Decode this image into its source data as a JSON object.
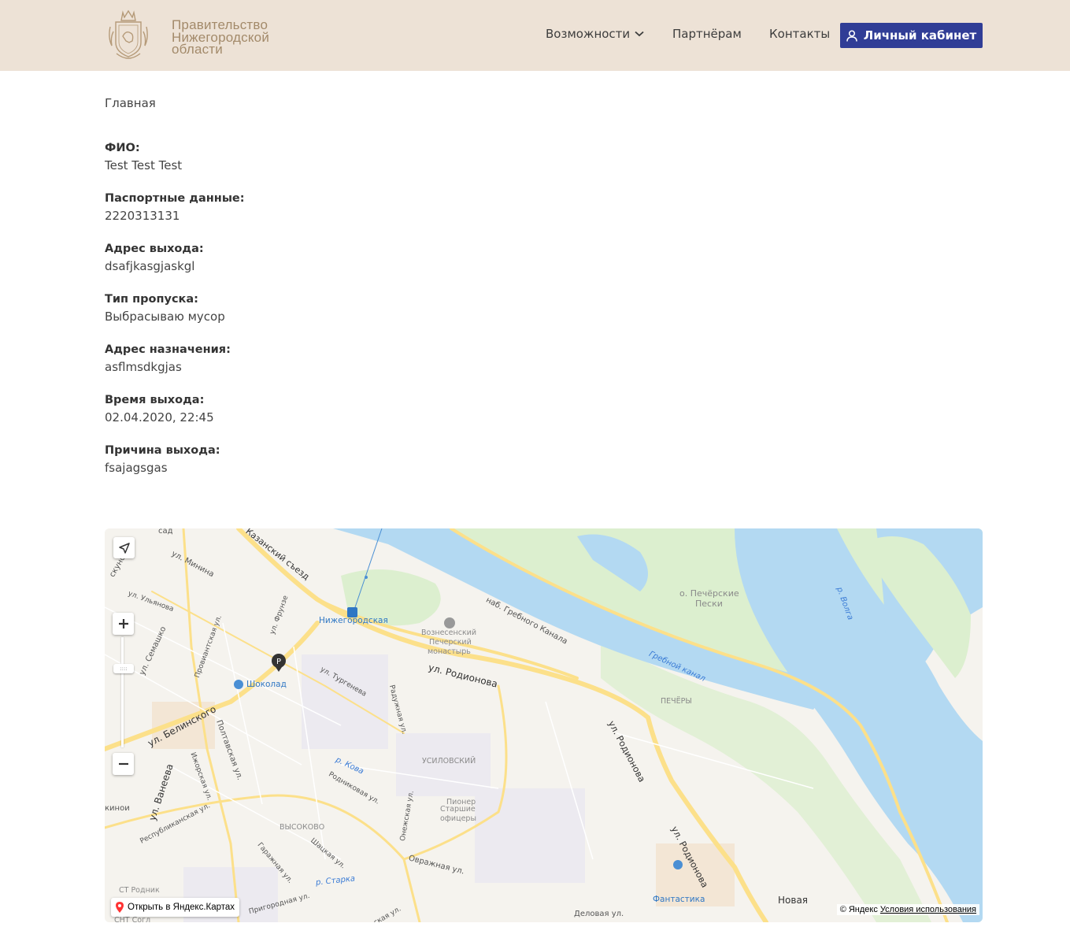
{
  "header": {
    "logo_lines": [
      "Правительство",
      "Нижегородской",
      "области"
    ],
    "nav": {
      "features": "Возможности",
      "partners": "Партнёрам",
      "contacts": "Контакты"
    },
    "cabinet_button": "Личный кабинет",
    "colors": {
      "background": "#ede2d6",
      "button": "#303d96",
      "logo_text": "#a38a6a"
    }
  },
  "breadcrumb": "Главная",
  "fields": [
    {
      "label": "ФИО:",
      "value": "Test Test Test"
    },
    {
      "label": "Паспортные данные:",
      "value": "2220313131"
    },
    {
      "label": "Адрес выхода:",
      "value": "dsafjkasgjaskgl"
    },
    {
      "label": "Тип пропуска:",
      "value": "Выбрасываю мусор"
    },
    {
      "label": "Адрес назначения:",
      "value": "asflmsdkgjas"
    },
    {
      "label": "Время выхода:",
      "value": "02.04.2020, 22:45"
    },
    {
      "label": "Причина выхода:",
      "value": "fsajagsgas"
    }
  ],
  "map": {
    "labels": {
      "sad": "сад",
      "kazansky": "Казанский съезд",
      "minina": "ул. Минина",
      "iskunov": "скунов",
      "ulyanova": "ул. Ульянова",
      "frunze": "ул. Фрунзе",
      "provianskaya": "Провиантская ул.",
      "semashko": "ул. Семашко",
      "nizhegorodskaya": "Нижегородская",
      "monastery_1": "Вознесенский",
      "monastery_2": "Печерский",
      "monastery_3": "монастырь",
      "grebnogo": "наб. Гребного Канала",
      "pecherskie_1": "о. Печёрские",
      "pecherskie_2": "Пески",
      "volga": "р. Волга",
      "grebnoy": "Гребной канал",
      "pechery": "ПЕЧЁРЫ",
      "rodionova_1": "ул. Родионова",
      "turgeneva": "ул. Тургенева",
      "shokolad": "Шоколад",
      "belinskogo": "ул. Белинского",
      "radishcheva": "Радужная ул.",
      "poltavskaya": "Полтавская ул.",
      "izhorskaya": "Ижорская ул.",
      "kova": "р. Кова",
      "usilovsky": "УСИЛОВСКИЙ",
      "rodionova_2": "ул. Родионова",
      "vaneeva": "ул. Ванеева",
      "rodnikovaya": "Родниковая ул.",
      "onezhskaya": "Онежская ул.",
      "pioneer": "Пионер",
      "officers_1": "Старшие",
      "officers_2": "офицеры",
      "kinoy": "кинои",
      "vysokovo": "ВЫСОКОВО",
      "respublikanskaya": "Республиканская ул.",
      "shatskaya": "Шацкая ул.",
      "garazhnaya": "Гаражная ул.",
      "ovrazhnaya": "Овражная ул.",
      "rodionova_3": "ул. Родионова",
      "starka": "р. Старка",
      "st_rodnik": "СТ Родник",
      "prigorodnaya": "Пригородная ул.",
      "fantastika": "Фантастика",
      "novaya": "Новая",
      "delovaya": "Деловая ул.",
      "snt": "СНТ Согл",
      "grichesky": "ческая ул."
    },
    "open_in_yandex": "Открыть в Яндекс.Картах",
    "copyright": "© Яндекс",
    "terms": "Условия использования",
    "colors": {
      "water": "#b3d9f2",
      "park": "#dcefcf",
      "road": "#fce08a",
      "land": "#f5f3ee"
    }
  }
}
